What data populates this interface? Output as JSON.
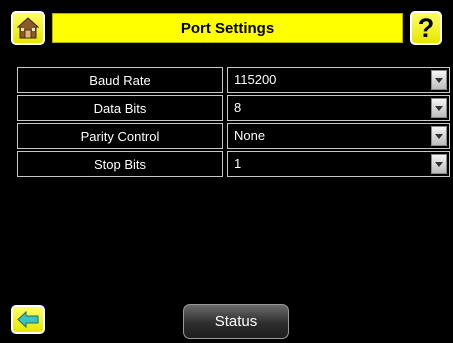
{
  "header": {
    "title": "Port Settings",
    "home_icon": "home-icon",
    "help_icon": "help-icon",
    "help_glyph": "?"
  },
  "settings": [
    {
      "label": "Baud Rate",
      "value": "115200"
    },
    {
      "label": "Data Bits",
      "value": "8"
    },
    {
      "label": "Parity Control",
      "value": "None"
    },
    {
      "label": "Stop Bits",
      "value": "1"
    }
  ],
  "footer": {
    "back_icon": "back-arrow-icon",
    "status_label": "Status"
  },
  "colors": {
    "accent": "#ffff00",
    "background": "#000000",
    "text": "#ffffff"
  }
}
